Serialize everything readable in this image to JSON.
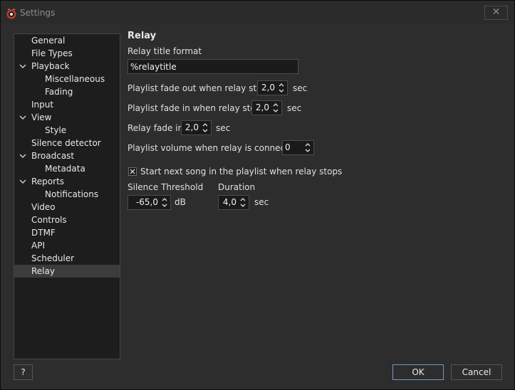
{
  "window": {
    "title": "Settings",
    "close_label": "✕",
    "app_icon": "radio-app-icon"
  },
  "tree": {
    "items": [
      {
        "label": "General",
        "level": 0,
        "expanded": false,
        "selected": false
      },
      {
        "label": "File Types",
        "level": 0,
        "expanded": false,
        "selected": false
      },
      {
        "label": "Playback",
        "level": 0,
        "expanded": true,
        "selected": false
      },
      {
        "label": "Miscellaneous",
        "level": 1,
        "expanded": false,
        "selected": false
      },
      {
        "label": "Fading",
        "level": 1,
        "expanded": false,
        "selected": false
      },
      {
        "label": "Input",
        "level": 0,
        "expanded": false,
        "selected": false
      },
      {
        "label": "View",
        "level": 0,
        "expanded": true,
        "selected": false
      },
      {
        "label": "Style",
        "level": 1,
        "expanded": false,
        "selected": false
      },
      {
        "label": "Silence detector",
        "level": 0,
        "expanded": false,
        "selected": false
      },
      {
        "label": "Broadcast",
        "level": 0,
        "expanded": true,
        "selected": false
      },
      {
        "label": "Metadata",
        "level": 1,
        "expanded": false,
        "selected": false
      },
      {
        "label": "Reports",
        "level": 0,
        "expanded": true,
        "selected": false
      },
      {
        "label": "Notifications",
        "level": 1,
        "expanded": false,
        "selected": false
      },
      {
        "label": "Video",
        "level": 0,
        "expanded": false,
        "selected": false
      },
      {
        "label": "Controls",
        "level": 0,
        "expanded": false,
        "selected": false
      },
      {
        "label": "DTMF",
        "level": 0,
        "expanded": false,
        "selected": false
      },
      {
        "label": "API",
        "level": 0,
        "expanded": false,
        "selected": false
      },
      {
        "label": "Scheduler",
        "level": 0,
        "expanded": false,
        "selected": false
      },
      {
        "label": "Relay",
        "level": 0,
        "expanded": false,
        "selected": true
      }
    ]
  },
  "relay": {
    "section_title": "Relay",
    "title_format_label": "Relay title format",
    "title_format_value": "%relaytitle",
    "fade_out_label": "Playlist fade out when relay starts",
    "fade_out_value": "2,0",
    "fade_out_unit": "sec",
    "fade_in_label": "Playlist fade in when relay stops",
    "fade_in_value": "2,0",
    "fade_in_unit": "sec",
    "relay_fade_in_label": "Relay fade in",
    "relay_fade_in_value": "2,0",
    "relay_fade_in_unit": "sec",
    "volume_label": "Playlist volume when relay is connected",
    "volume_value": "0",
    "start_next_label": "Start next song in the playlist when relay stops",
    "start_next_checked": true,
    "silence_threshold_label": "Silence Threshold",
    "silence_threshold_value": "-65,0",
    "silence_threshold_unit": "dB",
    "duration_label": "Duration",
    "duration_value": "4,0",
    "duration_unit": "sec"
  },
  "footer": {
    "help_label": "?",
    "ok_label": "OK",
    "cancel_label": "Cancel"
  },
  "colors": {
    "background": "#2d2d2d",
    "panel": "#1d1d1d",
    "selected": "#3c3c3c",
    "ok_border": "#6f9ac8"
  }
}
